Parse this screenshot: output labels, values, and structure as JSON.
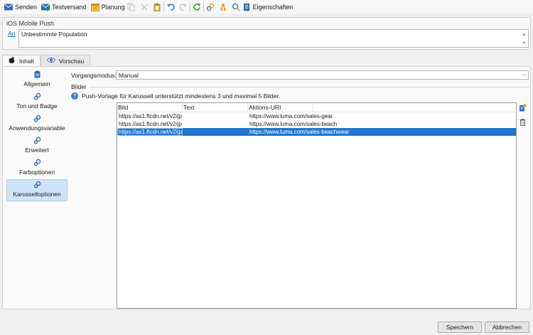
{
  "toolbar": {
    "send_label": "Senden",
    "test_label": "Testversand",
    "schedule_label": "Planung",
    "properties_label": "Eigenschaften"
  },
  "header": {
    "title": "iOS Mobile Push",
    "link_label": "An",
    "target_value": "Unbestimmte Population"
  },
  "tabs": [
    {
      "label": "Inhalt",
      "icon": "apple-icon"
    },
    {
      "label": "Vorschau",
      "icon": "eye-icon"
    }
  ],
  "sidebar": {
    "items": [
      {
        "label": "Allgemein",
        "icon": "clipboard-icon"
      },
      {
        "label": "Ton und Badge",
        "icon": "gears-icon"
      },
      {
        "label": "Anwendungsvariable",
        "icon": "gears-icon"
      },
      {
        "label": "Erweitert",
        "icon": "gears-icon"
      },
      {
        "label": "Farboptionen",
        "icon": "gears-icon"
      },
      {
        "label": "Karusselloptionen",
        "icon": "gears-icon",
        "active": true
      }
    ]
  },
  "form": {
    "mode_label": "Vorgangsmodus:",
    "mode_value": "Manual",
    "images_section": "Bilder",
    "info_text": "Push-Vorlage für Karussell unterstützt mindestens 3 und maximal 5 Bilder."
  },
  "grid": {
    "columns": [
      "Bild",
      "Text",
      "Aktions-URI"
    ],
    "rows": [
      {
        "bild": "https://as1.ftcdn.net/v2/jp",
        "text": "",
        "uri": "https://www.luma.com/sales-gear"
      },
      {
        "bild": "https://as1.ftcdn.net/v2/jp",
        "text": "",
        "uri": "https://www.luma.com/sales-beach"
      },
      {
        "bild": "https://as1.ftcdn.net/v2/jp",
        "text": "",
        "uri": "https://www.luma.com/sales-beachwear"
      }
    ]
  },
  "buttons": {
    "save": "Speichern",
    "cancel": "Abbrechen"
  },
  "colors": {
    "selection": "#1f77d0",
    "sidebar_active": "#cfe4f8"
  }
}
